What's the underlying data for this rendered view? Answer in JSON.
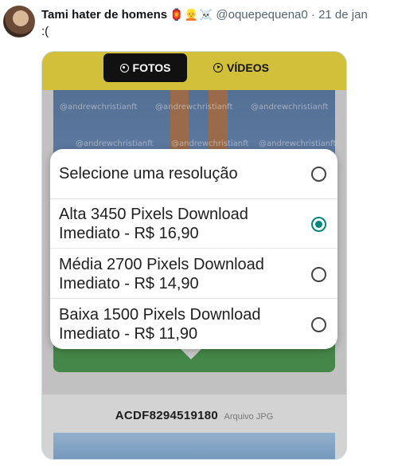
{
  "tweet": {
    "author_name": "Tami hater de homens",
    "author_emojis": "🏮👱☠️",
    "handle": "@oquepequena0",
    "separator": "·",
    "date": "21 de jan",
    "text": ":("
  },
  "app": {
    "tabs": [
      {
        "label": "FOTOS",
        "icon": "camera-icon",
        "active": true
      },
      {
        "label": "VÍDEOS",
        "icon": "play-icon",
        "active": false
      }
    ],
    "watermark": "@andrewchristianft",
    "accent_color": "#d3c03a",
    "button_color": "#4f9a52",
    "photo_code": "ACDF8294519180",
    "file_type": "Arquivo JPG"
  },
  "dialog": {
    "title": "Selecione uma resolução",
    "options": [
      {
        "line1": "Alta 3450 Pixels Download",
        "line2": "Imediato - R$ 16,90",
        "selected": true
      },
      {
        "line1": "Média 2700 Pixels Download",
        "line2": "Imediato - R$ 14,90",
        "selected": false
      },
      {
        "line1": "Baixa 1500 Pixels Download",
        "line2": "Imediato - R$ 11,90",
        "selected": false
      }
    ],
    "radio_color": "#00897b"
  }
}
